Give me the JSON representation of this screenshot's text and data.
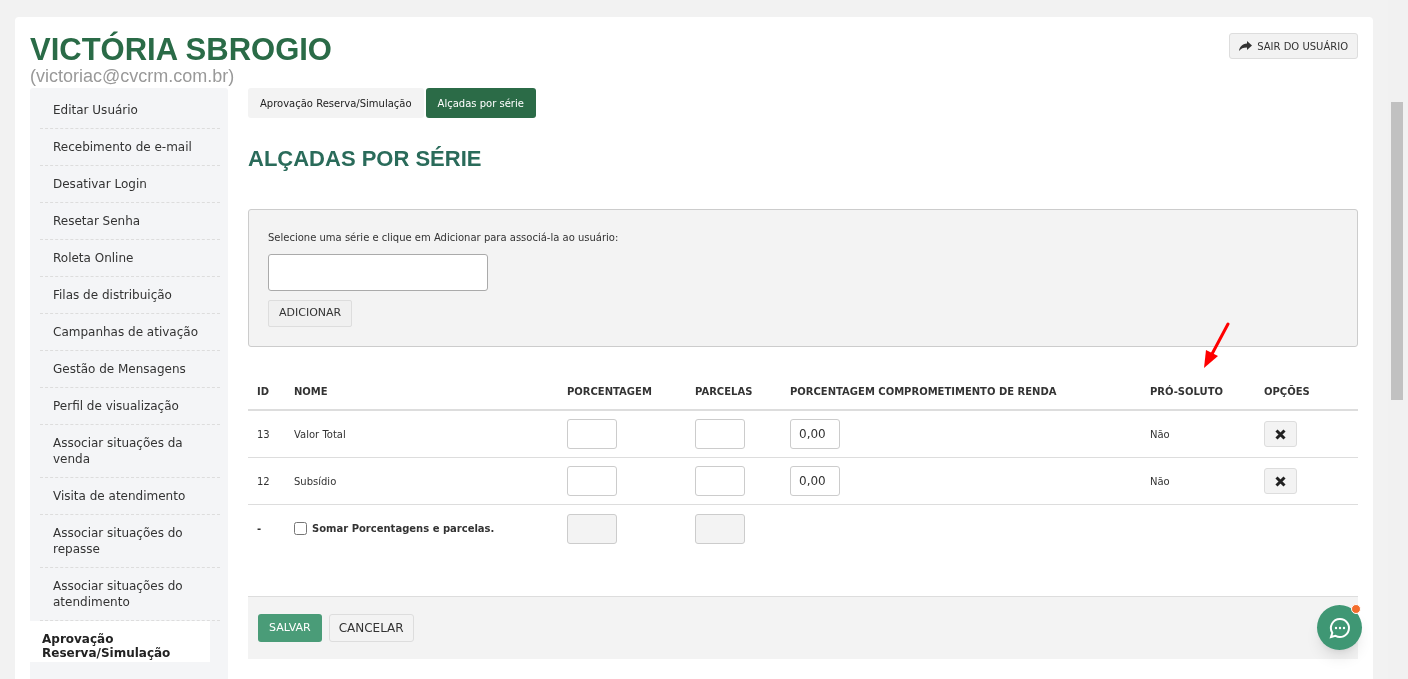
{
  "user": {
    "name": "VICTÓRIA SBROGIO",
    "email": "(victoriac@cvcrm.com.br)"
  },
  "logout_button": "SAIR DO USUÁRIO",
  "sidebar": {
    "items": [
      {
        "label": "Editar Usuário",
        "selected": false
      },
      {
        "label": "Recebimento de e-mail",
        "selected": false
      },
      {
        "label": "Desativar Login",
        "selected": false
      },
      {
        "label": "Resetar Senha",
        "selected": false
      },
      {
        "label": "Roleta Online",
        "selected": false
      },
      {
        "label": "Filas de distribuição",
        "selected": false
      },
      {
        "label": "Campanhas de ativação",
        "selected": false
      },
      {
        "label": "Gestão de Mensagens",
        "selected": false
      },
      {
        "label": "Perfil de visualização",
        "selected": false
      },
      {
        "label": "Associar situações da venda",
        "selected": false
      },
      {
        "label": "Visita de atendimento",
        "selected": false
      },
      {
        "label": "Associar situações do repasse",
        "selected": false
      },
      {
        "label": "Associar situações do atendimento",
        "selected": false
      },
      {
        "label": "Aprovação Reserva/Simulação",
        "selected": true
      }
    ]
  },
  "tabs": [
    {
      "label": "Aprovação Reserva/Simulação",
      "selected": false
    },
    {
      "label": "Alçadas por série",
      "selected": true
    }
  ],
  "heading": "ALÇADAS POR SÉRIE",
  "add_panel": {
    "instruction": "Selecione uma série e clique em Adicionar para associá-la ao usuário:",
    "button": "ADICIONAR"
  },
  "table": {
    "columns": [
      "ID",
      "NOME",
      "PORCENTAGEM",
      "PARCELAS",
      "PORCENTAGEM COMPROMETIMENTO DE RENDA",
      "PRÓ-SOLUTO",
      "OPÇÕES"
    ],
    "rows": [
      {
        "id": "13",
        "name": "Valor Total",
        "income_commitment": "0,00",
        "pro_soluto": "Não"
      },
      {
        "id": "12",
        "name": "Subsídio",
        "income_commitment": "0,00",
        "pro_soluto": "Não"
      }
    ],
    "summary_row": {
      "id": "-",
      "label": "Somar Porcentagens e parcelas.",
      "checked": false
    }
  },
  "footer_buttons": [
    {
      "label": "SALVAR",
      "kind": "primary"
    },
    {
      "label": "CANCELAR",
      "kind": "secondary"
    }
  ]
}
